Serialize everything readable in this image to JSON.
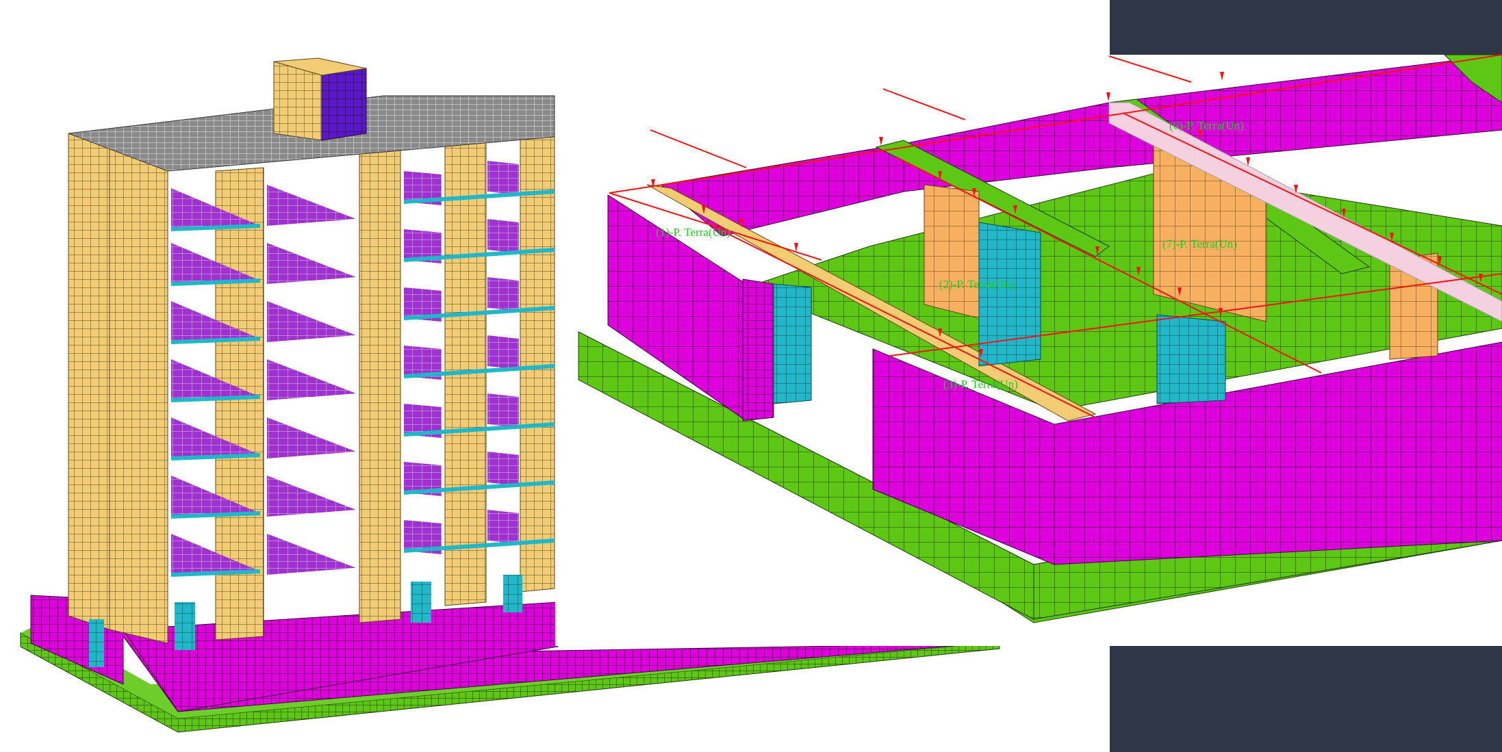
{
  "labels": {
    "load_1": "(1)-P. Terra(Un)",
    "load_2": "(2)-P. Terra(Un)",
    "load_3": "(3)-P. Terra(Un)",
    "load_6": "(6)-P. Terra(Un)",
    "load_7": "(7)-P. Terra(Un)"
  },
  "colors": {
    "background": "#2e3747",
    "canvas": "#ffffff",
    "foundation_green": "#5cc814",
    "wall_magenta": "#dd00dd",
    "frame_yellow": "#f2cc72",
    "slab_purple": "#a030d0",
    "column_cyan": "#20b8c8",
    "load_red": "#ff1010",
    "mesh_line": "#202020"
  }
}
